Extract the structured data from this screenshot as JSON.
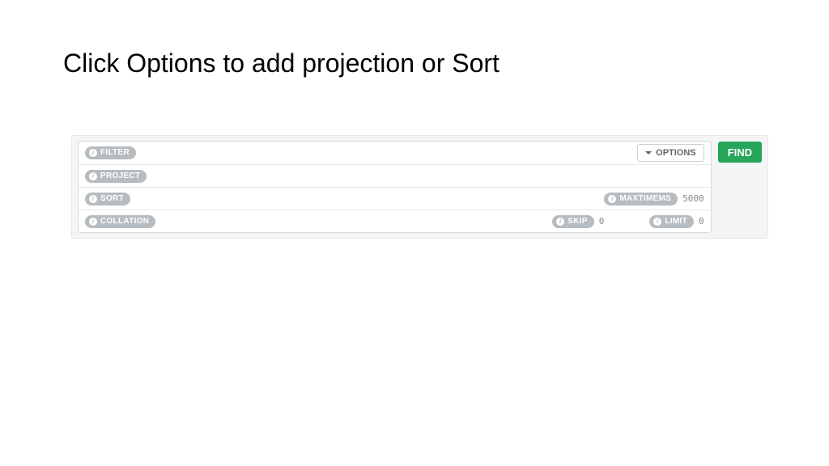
{
  "title": "Click Options to add projection or Sort",
  "query": {
    "filter_label": "FILTER",
    "project_label": "PROJECT",
    "sort_label": "SORT",
    "collation_label": "COLLATION",
    "maxtimems_label": "MAXTIMEMS",
    "maxtimems_value": "5000",
    "skip_label": "SKIP",
    "skip_value": "0",
    "limit_label": "LIMIT",
    "limit_value": "0",
    "options_label": "OPTIONS",
    "find_label": "FIND"
  }
}
